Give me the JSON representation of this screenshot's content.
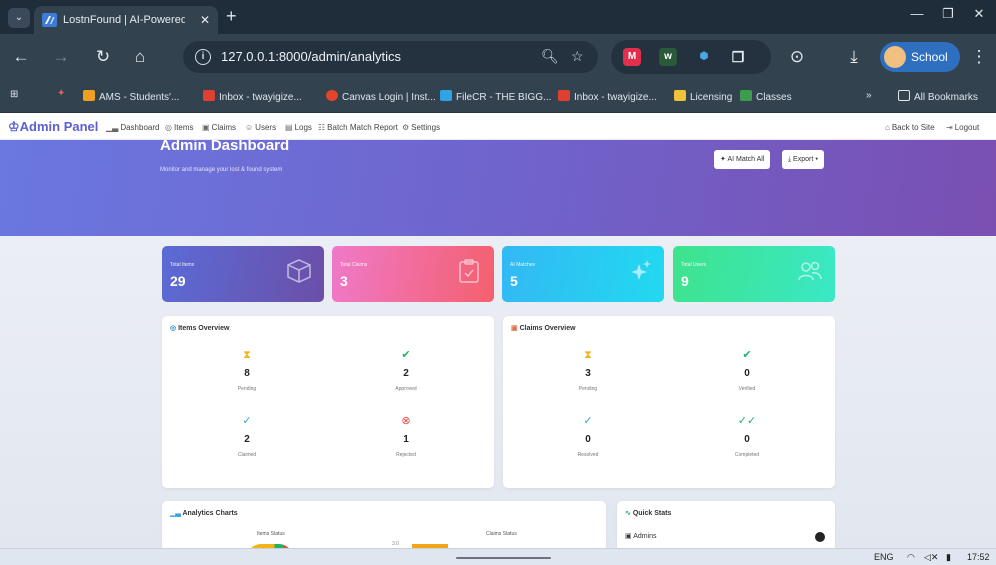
{
  "browser": {
    "tab_title": "LostnFound | AI-Powered Lo",
    "url": "127.0.0.1:8000/admin/analytics",
    "profile_label": "School",
    "bookmarks": [
      "AMS - Students'...",
      "Inbox - twayigize...",
      "Canvas Login | Inst...",
      "FileCR - THE BIGG...",
      "Inbox - twayigize...",
      "Licensing",
      "Classes"
    ],
    "all_bookmarks": "All Bookmarks",
    "overflow": "»"
  },
  "admin_nav": {
    "brand": "Admin Panel",
    "items": [
      "Dashboard",
      "Items",
      "Claims",
      "Users",
      "Logs",
      "Batch Match Report",
      "Settings"
    ],
    "back": "Back to Site",
    "logout": "Logout"
  },
  "hero": {
    "title": "Admin Dashboard",
    "subtitle": "Monitor and manage your lost & found system",
    "ai_match": "AI Match All",
    "export": "Export"
  },
  "stats": [
    {
      "label": "Total Items",
      "value": "29",
      "icon": "cube-icon",
      "from": "#5b6bd6",
      "to": "#6b4fa8"
    },
    {
      "label": "Total Claims",
      "value": "3",
      "icon": "clipboard-check-icon",
      "from": "#ef79c9",
      "to": "#f4606d"
    },
    {
      "label": "AI Matches",
      "value": "5",
      "icon": "sparkle-icon",
      "from": "#33b8f4",
      "to": "#22d9f0"
    },
    {
      "label": "Total Users",
      "value": "9",
      "icon": "users-icon",
      "from": "#3ee38c",
      "to": "#3ae8c6"
    }
  ],
  "items_overview": {
    "title": "Items Overview",
    "metrics": [
      {
        "value": "8",
        "label": "Pending",
        "icon": "hourglass-icon",
        "color": "#f2b416"
      },
      {
        "value": "2",
        "label": "Approved",
        "icon": "check-circle-icon",
        "color": "#22b266"
      },
      {
        "value": "2",
        "label": "Claimed",
        "icon": "check-icon",
        "color": "#2aa7e6"
      },
      {
        "value": "1",
        "label": "Rejected",
        "icon": "x-circle-icon",
        "color": "#e54b4b"
      }
    ]
  },
  "claims_overview": {
    "title": "Claims Overview",
    "metrics": [
      {
        "value": "3",
        "label": "Pending",
        "icon": "hourglass-icon",
        "color": "#f2b416"
      },
      {
        "value": "0",
        "label": "Verified",
        "icon": "check-circle-icon",
        "color": "#22b266"
      },
      {
        "value": "0",
        "label": "Resolved",
        "icon": "check-icon",
        "color": "#2aa7e6"
      },
      {
        "value": "0",
        "label": "Completed",
        "icon": "double-check-icon",
        "color": "#22b266"
      }
    ]
  },
  "analytics": {
    "title": "Analytics Charts",
    "items_status": "Items Status",
    "claims_status": "Claims Status",
    "claims_axis_tick": "3.0"
  },
  "quick_stats": {
    "title": "Quick Stats",
    "admins_label": "Admins"
  },
  "taskbar": {
    "lang": "ENG",
    "time": "17:52"
  }
}
